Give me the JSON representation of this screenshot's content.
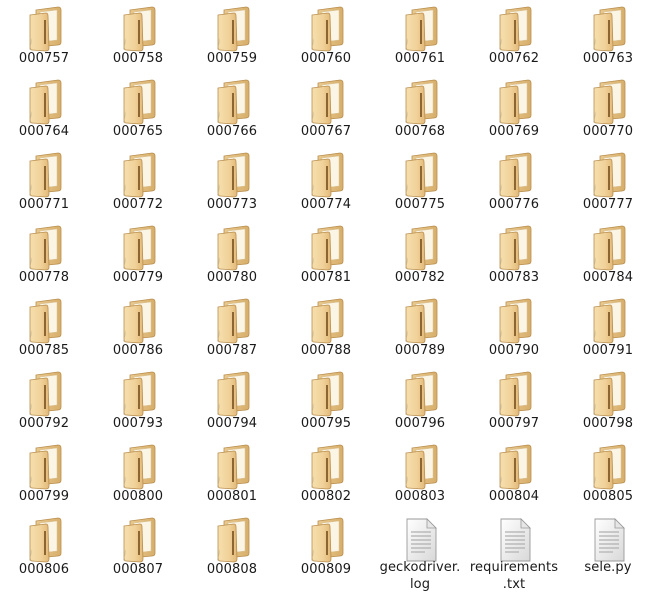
{
  "file_manager": {
    "items": [
      {
        "type": "folder",
        "icon": "folder-icon",
        "name": [
          "000757"
        ]
      },
      {
        "type": "folder",
        "icon": "folder-icon",
        "name": [
          "000758"
        ]
      },
      {
        "type": "folder",
        "icon": "folder-icon",
        "name": [
          "000759"
        ]
      },
      {
        "type": "folder",
        "icon": "folder-icon",
        "name": [
          "000760"
        ]
      },
      {
        "type": "folder",
        "icon": "folder-icon",
        "name": [
          "000761"
        ]
      },
      {
        "type": "folder",
        "icon": "folder-icon",
        "name": [
          "000762"
        ]
      },
      {
        "type": "folder",
        "icon": "folder-icon",
        "name": [
          "000763"
        ]
      },
      {
        "type": "folder",
        "icon": "folder-icon",
        "name": [
          "000764"
        ]
      },
      {
        "type": "folder",
        "icon": "folder-icon",
        "name": [
          "000765"
        ]
      },
      {
        "type": "folder",
        "icon": "folder-icon",
        "name": [
          "000766"
        ]
      },
      {
        "type": "folder",
        "icon": "folder-icon",
        "name": [
          "000767"
        ]
      },
      {
        "type": "folder",
        "icon": "folder-icon",
        "name": [
          "000768"
        ]
      },
      {
        "type": "folder",
        "icon": "folder-icon",
        "name": [
          "000769"
        ]
      },
      {
        "type": "folder",
        "icon": "folder-icon",
        "name": [
          "000770"
        ]
      },
      {
        "type": "folder",
        "icon": "folder-icon",
        "name": [
          "000771"
        ]
      },
      {
        "type": "folder",
        "icon": "folder-icon",
        "name": [
          "000772"
        ]
      },
      {
        "type": "folder",
        "icon": "folder-icon",
        "name": [
          "000773"
        ]
      },
      {
        "type": "folder",
        "icon": "folder-icon",
        "name": [
          "000774"
        ]
      },
      {
        "type": "folder",
        "icon": "folder-icon",
        "name": [
          "000775"
        ]
      },
      {
        "type": "folder",
        "icon": "folder-icon",
        "name": [
          "000776"
        ]
      },
      {
        "type": "folder",
        "icon": "folder-icon",
        "name": [
          "000777"
        ]
      },
      {
        "type": "folder",
        "icon": "folder-icon",
        "name": [
          "000778"
        ]
      },
      {
        "type": "folder",
        "icon": "folder-icon",
        "name": [
          "000779"
        ]
      },
      {
        "type": "folder",
        "icon": "folder-icon",
        "name": [
          "000780"
        ]
      },
      {
        "type": "folder",
        "icon": "folder-icon",
        "name": [
          "000781"
        ]
      },
      {
        "type": "folder",
        "icon": "folder-icon",
        "name": [
          "000782"
        ]
      },
      {
        "type": "folder",
        "icon": "folder-icon",
        "name": [
          "000783"
        ]
      },
      {
        "type": "folder",
        "icon": "folder-icon",
        "name": [
          "000784"
        ]
      },
      {
        "type": "folder",
        "icon": "folder-icon",
        "name": [
          "000785"
        ]
      },
      {
        "type": "folder",
        "icon": "folder-icon",
        "name": [
          "000786"
        ]
      },
      {
        "type": "folder",
        "icon": "folder-icon",
        "name": [
          "000787"
        ]
      },
      {
        "type": "folder",
        "icon": "folder-icon",
        "name": [
          "000788"
        ]
      },
      {
        "type": "folder",
        "icon": "folder-icon",
        "name": [
          "000789"
        ]
      },
      {
        "type": "folder",
        "icon": "folder-icon",
        "name": [
          "000790"
        ]
      },
      {
        "type": "folder",
        "icon": "folder-icon",
        "name": [
          "000791"
        ]
      },
      {
        "type": "folder",
        "icon": "folder-icon",
        "name": [
          "000792"
        ]
      },
      {
        "type": "folder",
        "icon": "folder-icon",
        "name": [
          "000793"
        ]
      },
      {
        "type": "folder",
        "icon": "folder-icon",
        "name": [
          "000794"
        ]
      },
      {
        "type": "folder",
        "icon": "folder-icon",
        "name": [
          "000795"
        ]
      },
      {
        "type": "folder",
        "icon": "folder-icon",
        "name": [
          "000796"
        ]
      },
      {
        "type": "folder",
        "icon": "folder-icon",
        "name": [
          "000797"
        ]
      },
      {
        "type": "folder",
        "icon": "folder-icon",
        "name": [
          "000798"
        ]
      },
      {
        "type": "folder",
        "icon": "folder-icon",
        "name": [
          "000799"
        ]
      },
      {
        "type": "folder",
        "icon": "folder-icon",
        "name": [
          "000800"
        ]
      },
      {
        "type": "folder",
        "icon": "folder-icon",
        "name": [
          "000801"
        ]
      },
      {
        "type": "folder",
        "icon": "folder-icon",
        "name": [
          "000802"
        ]
      },
      {
        "type": "folder",
        "icon": "folder-icon",
        "name": [
          "000803"
        ]
      },
      {
        "type": "folder",
        "icon": "folder-icon",
        "name": [
          "000804"
        ]
      },
      {
        "type": "folder",
        "icon": "folder-icon",
        "name": [
          "000805"
        ]
      },
      {
        "type": "folder",
        "icon": "folder-icon",
        "name": [
          "000806"
        ]
      },
      {
        "type": "folder",
        "icon": "folder-icon",
        "name": [
          "000807"
        ]
      },
      {
        "type": "folder",
        "icon": "folder-icon",
        "name": [
          "000808"
        ]
      },
      {
        "type": "folder",
        "icon": "folder-icon",
        "name": [
          "000809"
        ]
      },
      {
        "type": "file",
        "icon": "text-file-icon",
        "name": [
          "geckodriver.",
          "log"
        ]
      },
      {
        "type": "file",
        "icon": "text-file-icon",
        "name": [
          "requirements",
          ".txt"
        ]
      },
      {
        "type": "file",
        "icon": "text-file-icon",
        "name": [
          "sele.py"
        ]
      }
    ]
  }
}
